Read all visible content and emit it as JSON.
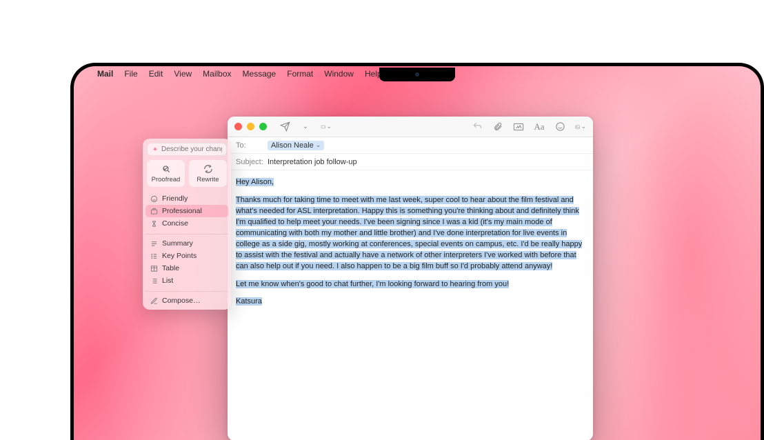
{
  "menubar": {
    "app": "Mail",
    "items": [
      "File",
      "Edit",
      "View",
      "Mailbox",
      "Message",
      "Format",
      "Window",
      "Help"
    ]
  },
  "compose": {
    "to_label": "To:",
    "to_recipient": "Alison Neale",
    "subject_label": "Subject:",
    "subject_value": "Interpretation job follow-up",
    "body": {
      "greeting": "Hey Alison,",
      "para1": "Thanks much for taking time to meet with me last week, super cool to hear about the film festival and what's needed for ASL interpretation. Happy this is something you're thinking about and definitely think I'm qualified to help meet your needs. I've been signing since I was a kid (it's my main mode of communicating with both my mother and little brother) and I've done interpretation for  live events in college as a side gig, mostly working at conferences, special events on campus, etc. I'd be really happy to assist with the festival and actually have a network of other interpreters I've worked with before that can also help out if you need. I also happen to be a big film buff so I'd probably attend anyway!",
      "para2": "Let me know when's good to chat further, I'm looking forward to hearing from you!",
      "signature": "Katsura"
    }
  },
  "ai_panel": {
    "search_placeholder": "Describe your change",
    "modes": {
      "proofread": "Proofread",
      "rewrite": "Rewrite"
    },
    "tone_items": [
      "Friendly",
      "Professional",
      "Concise"
    ],
    "transform_items": [
      "Summary",
      "Key Points",
      "Table",
      "List"
    ],
    "compose_item": "Compose…"
  }
}
